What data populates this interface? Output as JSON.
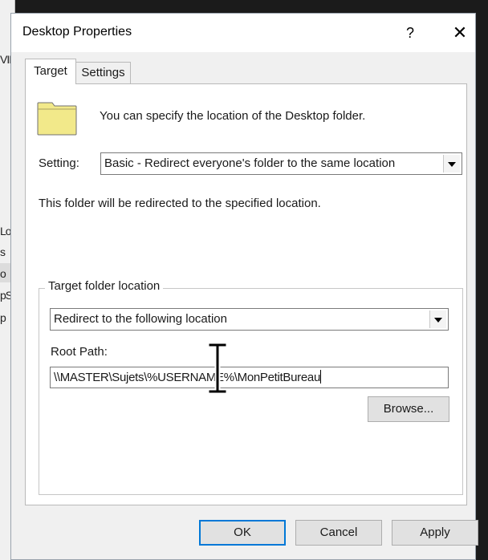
{
  "dialog": {
    "title": "Desktop Properties",
    "help_glyph": "?",
    "close_glyph": "✕"
  },
  "tabs": [
    {
      "label": "Target",
      "active": true
    },
    {
      "label": "Settings",
      "active": false
    }
  ],
  "target": {
    "info_text": "You can specify the location of the Desktop folder.",
    "setting_label": "Setting:",
    "setting_value": "Basic - Redirect everyone's folder to the same location",
    "redirect_text": "This folder will be redirected to the specified location.",
    "group_label": "Target folder location",
    "location_value": "Redirect to the following location",
    "root_path_label": "Root Path:",
    "root_path_value": "\\\\MASTER\\Sujets\\%USERNAME%\\MonPetitBureau",
    "browse_label": "Browse..."
  },
  "buttons": {
    "ok": "OK",
    "cancel": "Cancel",
    "apply": "Apply"
  },
  "background_window": {
    "fragments": [
      "VIL",
      "Lo",
      "s",
      "o",
      "pS",
      "p"
    ]
  },
  "colors": {
    "folder": "#f2e98a",
    "focus_border": "#0078d7",
    "window_bg": "#f0f0f0"
  },
  "icons": [
    "folder-icon",
    "close-icon",
    "help-icon",
    "dropdown-arrow-icon",
    "text-cursor-icon"
  ]
}
